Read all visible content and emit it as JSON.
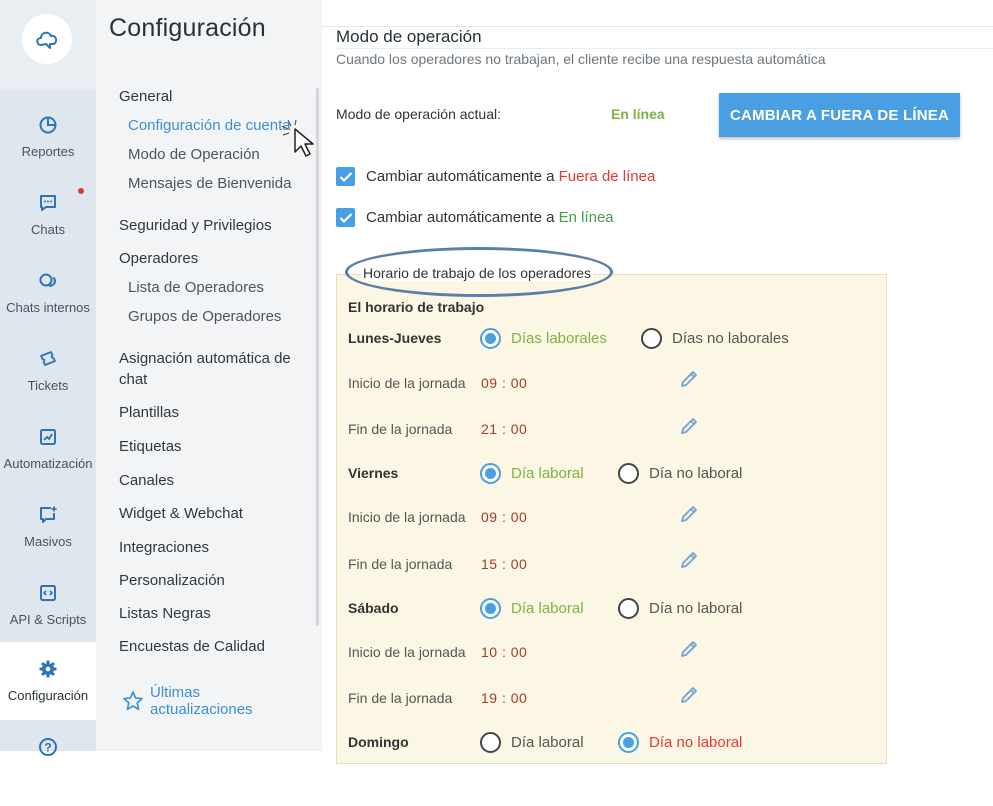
{
  "sidebar": {
    "items": [
      {
        "label": "Reportes",
        "icon": "pie-chart-icon"
      },
      {
        "label": "Chats",
        "icon": "chat-bubble-icon"
      },
      {
        "label": "Chats internos",
        "icon": "internal-chat-icon"
      },
      {
        "label": "Tickets",
        "icon": "ticket-icon"
      },
      {
        "label": "Automatización",
        "icon": "automation-chart-icon"
      },
      {
        "label": "Masivos",
        "icon": "broadcast-icon"
      },
      {
        "label": "API & Scripts",
        "icon": "code-icon"
      },
      {
        "label": "Configuración",
        "icon": "gear-icon",
        "active": true
      },
      {
        "label": "",
        "icon": "help-icon"
      }
    ],
    "logo": "cloud-logo-icon",
    "chats_badge": "notification-dot"
  },
  "settings_menu": {
    "title": "Configuración",
    "general": "General",
    "general_items": [
      "Configuración de cuenta",
      "Modo de Operación",
      "Mensajes de Bienvenida"
    ],
    "security": "Seguridad y Privilegios",
    "operators": "Operadores",
    "operator_items": [
      "Lista de Operadores",
      "Grupos de Operadores"
    ],
    "others": [
      "Asignación automática de chat",
      "Plantillas",
      "Etiquetas",
      "Canales",
      "Widget & Webchat",
      "Integraciones",
      "Personalización",
      "Listas Negras",
      "Encuestas de Calidad"
    ],
    "updates": "Últimas actualizaciones"
  },
  "main": {
    "section_title": "Modo de operación",
    "section_desc": "Cuando los operadores no trabajan, el cliente recibe una respuesta automática",
    "current_mode_label": "Modo de operación actual:",
    "current_mode_value": "En línea",
    "switch_button": "CAMBIAR A FUERA DE LÍNEA",
    "auto_offline_prefix": "Cambiar automáticamente a ",
    "auto_offline_target": "Fuera de línea",
    "auto_online_prefix": "Cambiar automáticamente a ",
    "auto_online_target": "En línea",
    "auto_offline_checked": true,
    "auto_online_checked": true
  },
  "schedule": {
    "legend": "Horario de trabajo de los operadores",
    "title": "El horario de trabajo",
    "start_label": "Inicio de la jornada",
    "end_label": "Fin de la jornada",
    "days": [
      {
        "name": "Lunes-Jueves",
        "opt_on": "Días laborales",
        "opt_off": "Días no laborales",
        "selected": "on",
        "start": "09 : 00",
        "end": "21 : 00"
      },
      {
        "name": "Viernes",
        "opt_on": "Día laboral",
        "opt_off": "Día no laboral",
        "selected": "on",
        "start": "09 : 00",
        "end": "15 : 00"
      },
      {
        "name": "Sábado",
        "opt_on": "Día laboral",
        "opt_off": "Día no laboral",
        "selected": "on",
        "start": "10 : 00",
        "end": "19 : 00"
      },
      {
        "name": "Domingo",
        "opt_on": "Día laboral",
        "opt_off": "Día no laboral",
        "selected": "off"
      }
    ]
  },
  "colors": {
    "accent": "#4a9fe3",
    "online": "#7cb342",
    "offline": "#e53935",
    "time": "#a33b2f"
  }
}
